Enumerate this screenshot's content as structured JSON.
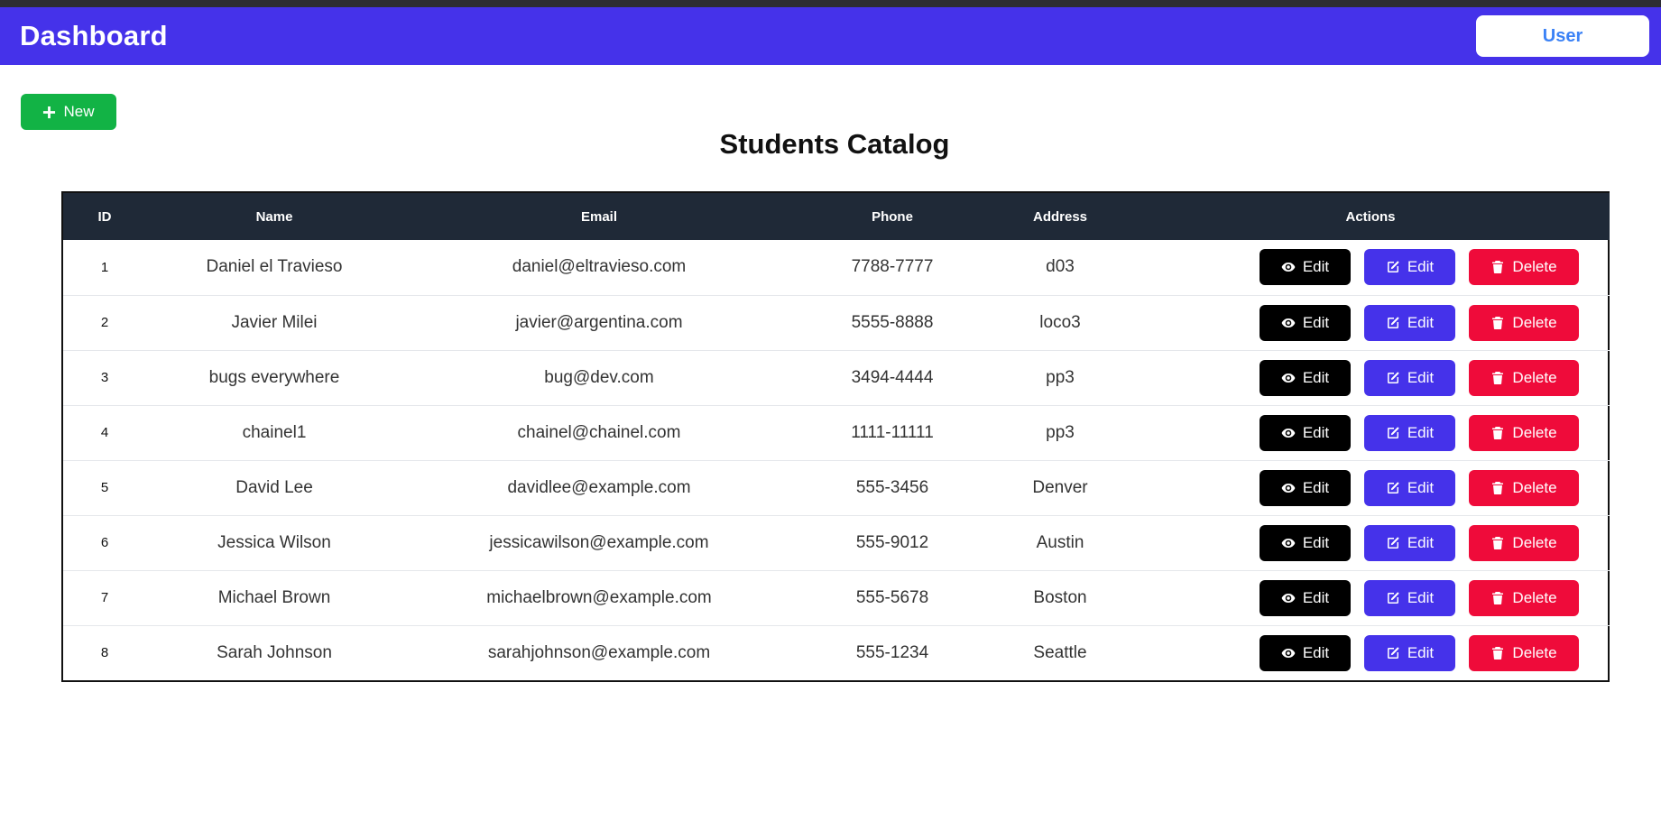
{
  "header": {
    "title": "Dashboard",
    "user_label": "User"
  },
  "toolbar": {
    "new_label": "New"
  },
  "page": {
    "title": "Students Catalog"
  },
  "table": {
    "columns": [
      "ID",
      "Name",
      "Email",
      "Phone",
      "Address",
      "Actions"
    ],
    "rows": [
      {
        "id": "1",
        "name": "Daniel el Travieso",
        "email": "daniel@eltravieso.com",
        "phone": "7788-7777",
        "address": "d03"
      },
      {
        "id": "2",
        "name": "Javier Milei",
        "email": "javier@argentina.com",
        "phone": "5555-8888",
        "address": "loco3"
      },
      {
        "id": "3",
        "name": "bugs everywhere",
        "email": "bug@dev.com",
        "phone": "3494-4444",
        "address": "pp3"
      },
      {
        "id": "4",
        "name": "chainel1",
        "email": "chainel@chainel.com",
        "phone": "1111-11111",
        "address": "pp3"
      },
      {
        "id": "5",
        "name": "David Lee",
        "email": "davidlee@example.com",
        "phone": "555-3456",
        "address": "Denver"
      },
      {
        "id": "6",
        "name": "Jessica Wilson",
        "email": "jessicawilson@example.com",
        "phone": "555-9012",
        "address": "Austin"
      },
      {
        "id": "7",
        "name": "Michael Brown",
        "email": "michaelbrown@example.com",
        "phone": "555-5678",
        "address": "Boston"
      },
      {
        "id": "8",
        "name": "Sarah Johnson",
        "email": "sarahjohnson@example.com",
        "phone": "555-1234",
        "address": "Seattle"
      }
    ],
    "actions": {
      "view_label": "Edit",
      "view_icon": "eye-icon",
      "edit_label": "Edit",
      "edit_icon": "pen-square-icon",
      "delete_label": "Delete",
      "delete_icon": "trash-icon"
    }
  },
  "colors": {
    "primary": "#4532ea",
    "success": "#12b345",
    "danger": "#ef0b3a",
    "dark": "#1f2937",
    "link": "#3b82f6"
  }
}
